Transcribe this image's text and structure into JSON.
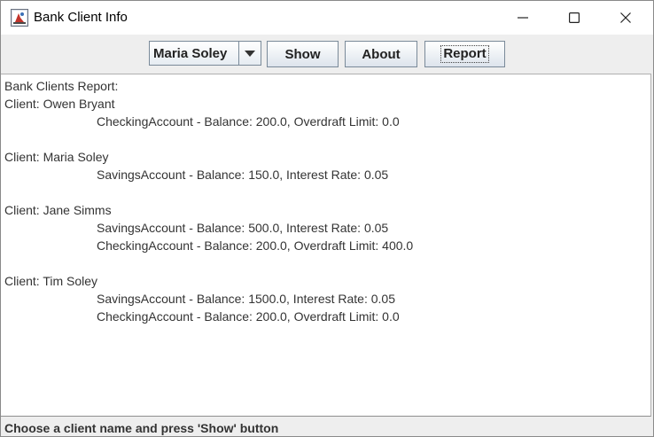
{
  "window": {
    "title": "Bank Client Info"
  },
  "toolbar": {
    "client_select": {
      "selected": "Maria Soley"
    },
    "show_label": "Show",
    "about_label": "About",
    "report_label": "Report"
  },
  "report": {
    "heading": "Bank Clients Report:",
    "clients": [
      {
        "label": "Client: Owen Bryant",
        "accounts": [
          "CheckingAccount - Balance: 200.0, Overdraft Limit: 0.0"
        ]
      },
      {
        "label": "Client: Maria Soley",
        "accounts": [
          "SavingsAccount - Balance: 150.0, Interest Rate: 0.05"
        ]
      },
      {
        "label": "Client: Jane Simms",
        "accounts": [
          "SavingsAccount - Balance: 500.0, Interest Rate: 0.05",
          "CheckingAccount - Balance: 200.0, Overdraft Limit: 400.0"
        ]
      },
      {
        "label": "Client: Tim Soley",
        "accounts": [
          "SavingsAccount - Balance: 1500.0, Interest Rate: 0.05",
          "CheckingAccount - Balance: 200.0, Overdraft Limit: 0.0"
        ]
      }
    ]
  },
  "status": {
    "text": "Choose a client name and press 'Show' button"
  },
  "icons": {
    "app": "java-app-icon",
    "minimize": "minimize-icon",
    "maximize": "maximize-icon",
    "close": "close-icon",
    "dropdown": "chevron-down-icon"
  },
  "colors": {
    "button_border": "#7a8a99",
    "background": "#eeeeee",
    "text": "#333333"
  }
}
